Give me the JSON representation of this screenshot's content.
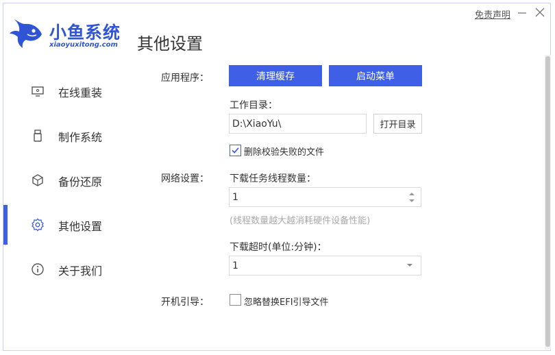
{
  "header": {
    "brand_name": "小鱼系统",
    "brand_domain": "xiaoyuxitong.com",
    "page_title": "其他设置",
    "disclaimer": "免责声明"
  },
  "sidebar": {
    "items": [
      {
        "label": "在线重装",
        "icon": "monitor-icon"
      },
      {
        "label": "制作系统",
        "icon": "usb-drive-icon"
      },
      {
        "label": "备份还原",
        "icon": "cube-restore-icon"
      },
      {
        "label": "其他设置",
        "icon": "gear-icon",
        "active": true
      },
      {
        "label": "关于我们",
        "icon": "info-icon"
      }
    ]
  },
  "app_section": {
    "label": "应用程序：",
    "clear_cache_button": "清理缓存",
    "boot_menu_button": "启动菜单",
    "work_dir_label": "工作目录：",
    "work_dir_value": "D:\\XiaoYu\\",
    "open_dir_button": "打开目录",
    "delete_failed_checkbox_label": "删除校验失败的文件",
    "delete_failed_checked": true
  },
  "network_section": {
    "label": "网络设置：",
    "thread_count_label": "下载任务线程数量：",
    "thread_count_value": "1",
    "thread_hint": "(线程数量越大越消耗硬件设备性能)",
    "timeout_label": "下载超时(单位:分钟)：",
    "timeout_value": "1"
  },
  "boot_section": {
    "label": "开机引导：",
    "ignore_efi_label": "忽略替换EFI引导文件",
    "ignore_efi_checked": false
  },
  "colors": {
    "accent": "#3e5fe6",
    "brand": "#2f55d4"
  }
}
